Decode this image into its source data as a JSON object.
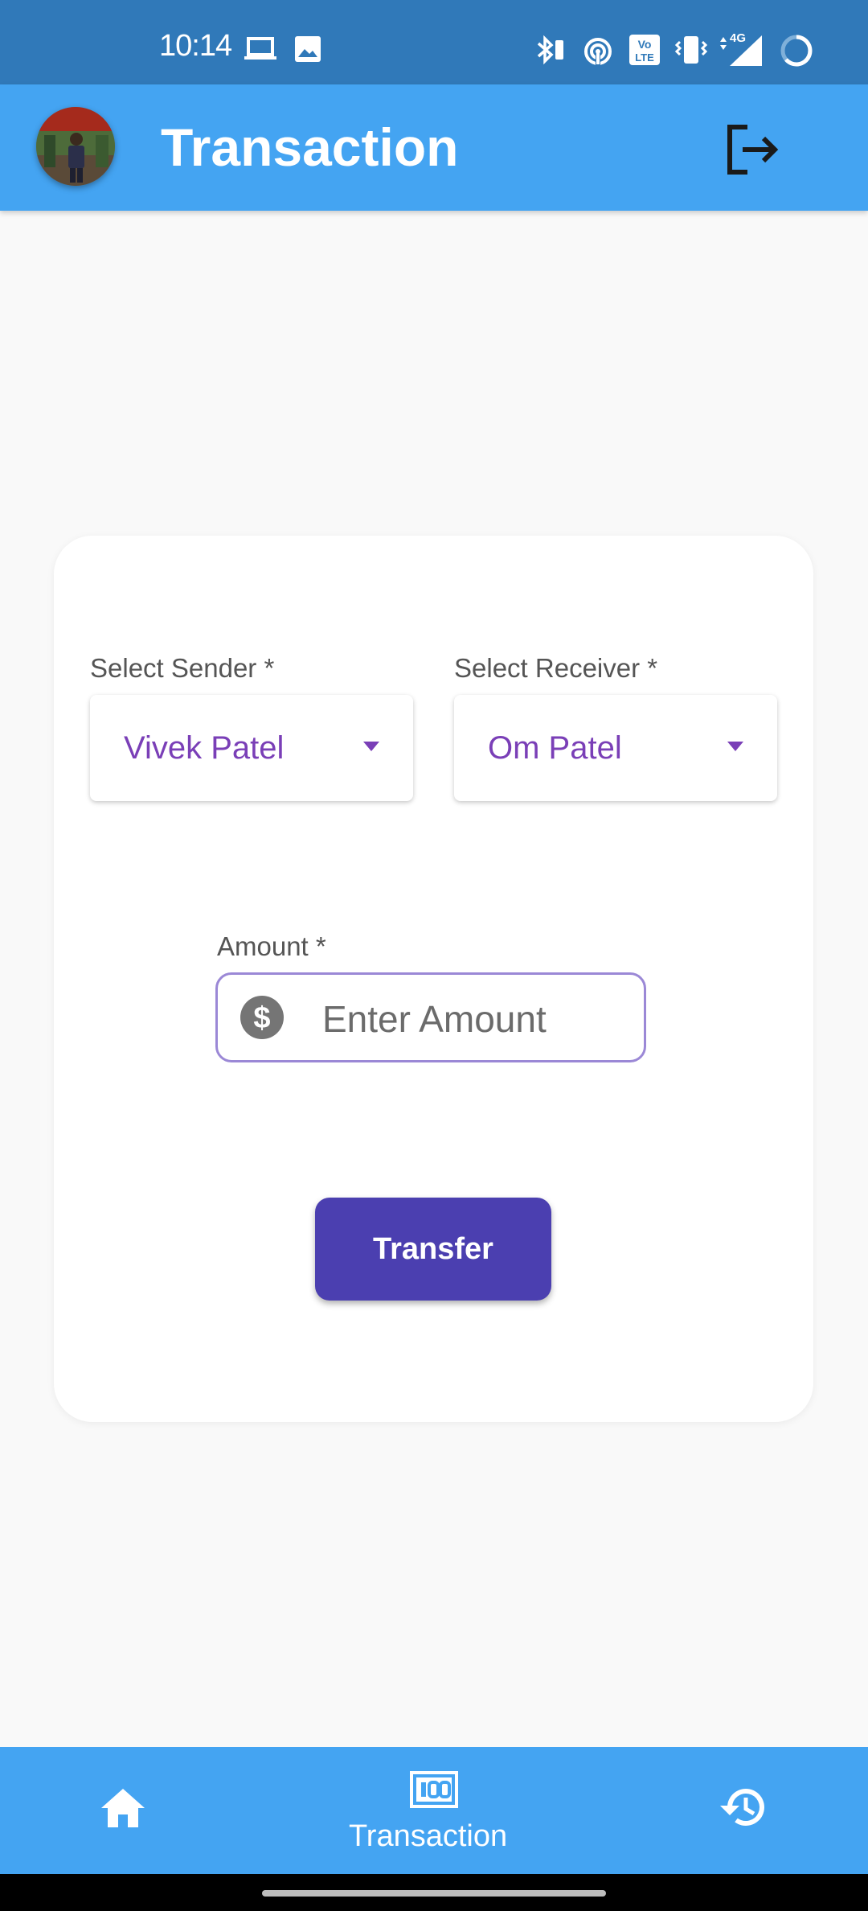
{
  "status_bar": {
    "time": "10:14",
    "icons": [
      "laptop-icon",
      "image-icon",
      "bluetooth-icon",
      "hotspot-icon",
      "volte-icon",
      "vibrate-icon",
      "signal-4g-icon",
      "battery-ring-icon"
    ],
    "network_label": "4G"
  },
  "app_bar": {
    "title": "Transaction",
    "avatar_icon": "profile-avatar",
    "logout_icon": "logout-icon"
  },
  "form": {
    "sender_label": "Select Sender *",
    "sender_value": "Vivek Patel",
    "receiver_label": "Select Receiver *",
    "receiver_value": "Om Patel",
    "amount_label": "Amount *",
    "amount_placeholder": "Enter Amount",
    "amount_value": "",
    "transfer_label": "Transfer"
  },
  "bottom_nav": {
    "items": [
      {
        "icon": "home-icon",
        "label": ""
      },
      {
        "icon": "money-icon",
        "label": "Transaction"
      },
      {
        "icon": "history-icon",
        "label": ""
      }
    ]
  },
  "colors": {
    "status_bar": "#3079b9",
    "app_bar": "#44a4f2",
    "accent_purple": "#7a3fb7",
    "button": "#4b3fb0"
  }
}
